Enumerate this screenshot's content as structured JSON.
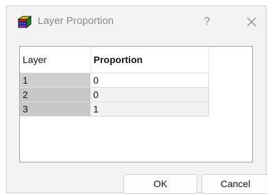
{
  "window": {
    "title": "Layer Proportion",
    "help_label": "?",
    "close_icon": "close-icon",
    "app_icon": "layer-cube-icon"
  },
  "table": {
    "headers": [
      "Layer",
      "Proportion"
    ],
    "rows": [
      {
        "layer": "1",
        "proportion": "0"
      },
      {
        "layer": "2",
        "proportion": "0"
      },
      {
        "layer": "3",
        "proportion": "1"
      }
    ]
  },
  "buttons": {
    "ok_label": "OK",
    "cancel_label": "Cancel"
  }
}
